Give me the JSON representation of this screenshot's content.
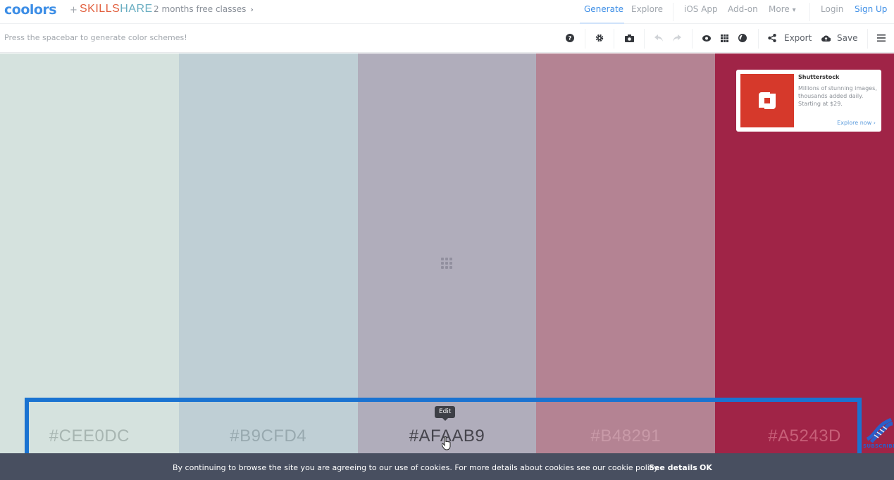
{
  "brand": {
    "logo": "coolors",
    "plus": "+",
    "partner_main": "SKILLS",
    "partner_tail": "HARE",
    "promo": "2 months free classes",
    "promo_chevron": "›"
  },
  "nav": {
    "generate": "Generate",
    "explore": "Explore",
    "ios_app": "iOS App",
    "addon": "Add-on",
    "more": "More",
    "more_chevron": "⌄",
    "login": "Login",
    "signup": "Sign Up"
  },
  "toolbar": {
    "hint": "Press the spacebar to generate color schemes!",
    "icons": {
      "help": "help-icon",
      "settings": "gear-icon",
      "camera": "camera-icon",
      "undo": "undo-icon",
      "redo": "redo-icon",
      "view": "eye-icon",
      "grid": "grid-icon",
      "contrast": "contrast-icon",
      "share": "share-icon",
      "cloud": "cloud-upload-icon",
      "menu": "hamburger-menu-icon"
    },
    "export": "Export",
    "save": "Save"
  },
  "palette": {
    "swatches": [
      {
        "hex": "#CEE0DC",
        "bg": "#d5e2de",
        "text_color": "#a7b5b1"
      },
      {
        "hex": "#B9CFD4",
        "bg": "#bfcfd5",
        "text_color": "#98a9af"
      },
      {
        "hex": "#AFAAB9",
        "bg": "#b0adbb",
        "text_color": "#45444c"
      },
      {
        "hex": "#B48291",
        "bg": "#b48393",
        "text_color": "#c99aa8"
      },
      {
        "hex": "#A5243D",
        "bg": "#a02447",
        "text_color": "#c75f78"
      }
    ],
    "tooltip": "Edit"
  },
  "ad": {
    "title": "Shutterstock",
    "text": "Millions of stunning images, thousands added daily. Starting at $29.",
    "link": "Explore now",
    "link_chevron": "›"
  },
  "cookie": {
    "text": "By continuing to browse the site you are agreeing to our use of cookies. For more details about cookies see our cookie policy.",
    "see_details": "See details",
    "ok": "OK"
  },
  "overlay": {
    "subscribe": "SUBSCRIBE",
    "highlight_color": "#1a73d1"
  }
}
